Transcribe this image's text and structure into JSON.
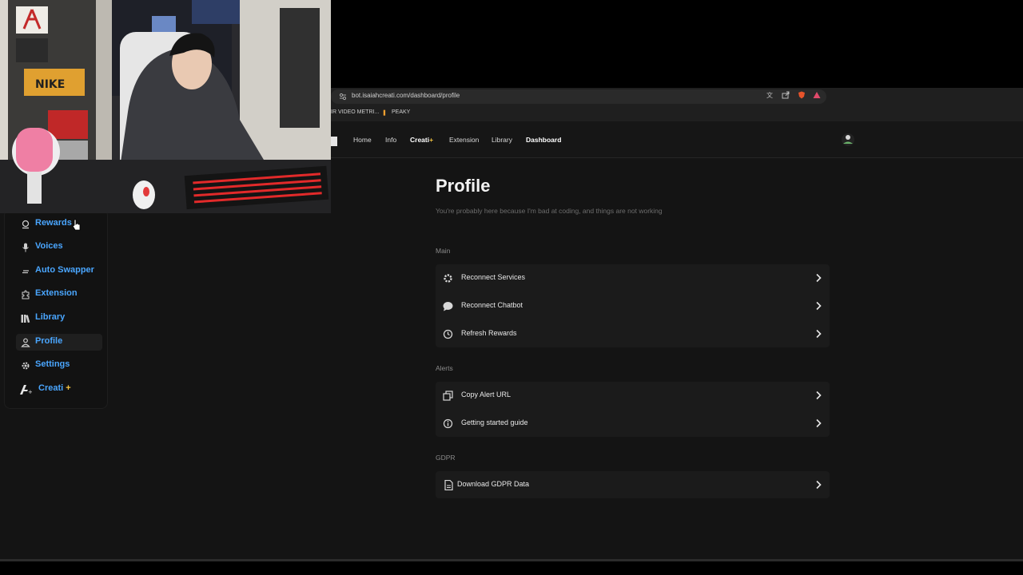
{
  "browser": {
    "url": "bot.isaiahcreati.com/dashboard/profile",
    "bookmarks": [
      "IR VIDEO METRI...",
      "PEAKY"
    ]
  },
  "nav": {
    "links": [
      "Home",
      "Info",
      "Creati",
      "Extension",
      "Library",
      "Dashboard"
    ],
    "plus": "+"
  },
  "sidebar": {
    "items": [
      {
        "label": "Rewards",
        "icon": "rewards-icon"
      },
      {
        "label": "Voices",
        "icon": "microphone-icon"
      },
      {
        "label": "Auto Swapper",
        "icon": "swap-icon"
      },
      {
        "label": "Extension",
        "icon": "puzzle-icon"
      },
      {
        "label": "Library",
        "icon": "library-icon"
      },
      {
        "label": "Profile",
        "icon": "user-icon",
        "active": true
      },
      {
        "label": "Settings",
        "icon": "gear-icon"
      },
      {
        "label": "Creati",
        "icon": "creati-logo-icon",
        "plus": "+"
      }
    ]
  },
  "page": {
    "title": "Profile",
    "subtitle": "You're probably here because I'm bad at coding, and things are not working",
    "sections": [
      {
        "label": "Main",
        "rows": [
          {
            "label": "Reconnect Services",
            "icon": "gear-icon"
          },
          {
            "label": "Reconnect Chatbot",
            "icon": "chat-bubble-icon"
          },
          {
            "label": "Refresh Rewards",
            "icon": "refresh-clock-icon"
          }
        ]
      },
      {
        "label": "Alerts",
        "rows": [
          {
            "label": "Copy Alert URL",
            "icon": "copy-icon"
          },
          {
            "label": "Getting started guide",
            "icon": "info-icon"
          }
        ]
      },
      {
        "label": "GDPR",
        "rows": [
          {
            "label": "Download GDPR Data",
            "icon": "document-icon"
          }
        ]
      }
    ]
  },
  "colors": {
    "accent_link": "#4aa6ff",
    "plus_gold": "#f5c542",
    "background": "#141414",
    "card": "#1b1b1b"
  }
}
